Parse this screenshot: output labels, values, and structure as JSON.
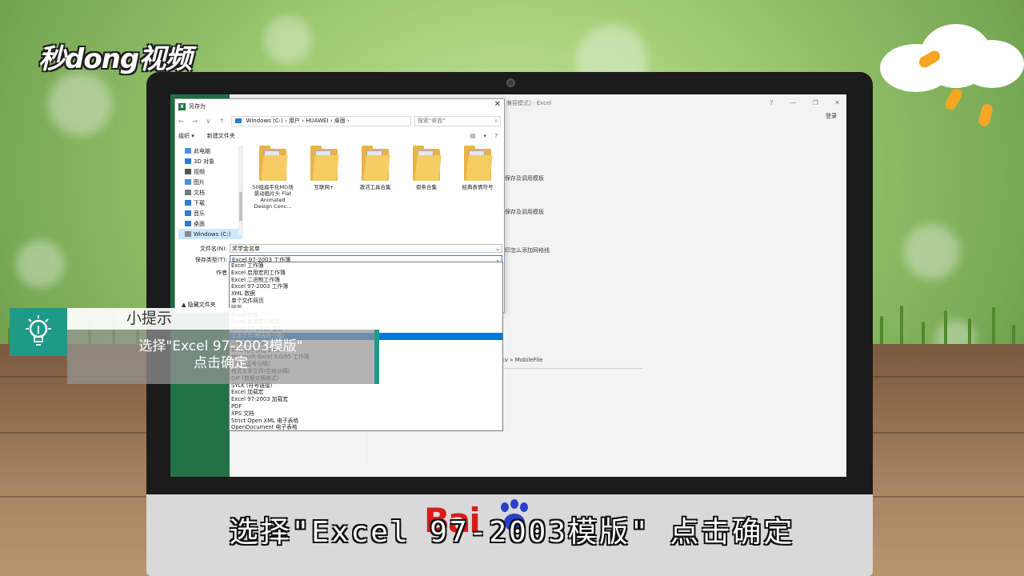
{
  "logo": {
    "text": "秒dong视频"
  },
  "excel": {
    "window_title": "兼容模式] - Excel",
    "window_buttons": "? — ❐ ✕",
    "login": "登录",
    "side_texts": [
      "保存及调用模板",
      "保存及调用模板",
      "印怎么添加网格线",
      "cv » MobileFile"
    ]
  },
  "dialog": {
    "title": "另存为",
    "close": "✕",
    "nav_arrows": "← → ∨ ↑",
    "breadcrumb": "Windows (C:)  ›  用户  ›  HUAWEI  ›  桌面  ›",
    "search_placeholder": "搜索\"桌面\"",
    "toolbar": {
      "organize": "组织 ▾",
      "new_folder": "新建文件夹",
      "view": "▤ ▾  ?"
    },
    "nav_items": [
      {
        "label": "此电脑",
        "color": "#4a90d9"
      },
      {
        "label": "3D 对象",
        "color": "#2b7cd3"
      },
      {
        "label": "视频",
        "color": "#555555"
      },
      {
        "label": "图片",
        "color": "#4a90d9"
      },
      {
        "label": "文档",
        "color": "#777777"
      },
      {
        "label": "下载",
        "color": "#2b7cd3"
      },
      {
        "label": "音乐",
        "color": "#2b7cd3"
      },
      {
        "label": "桌面",
        "color": "#2b7cd3"
      },
      {
        "label": "Windows (C:)",
        "color": "#888888"
      }
    ],
    "files": [
      {
        "name": "50组扁平化MG场景动画片头 Flat Animated Design Conc..."
      },
      {
        "name": "互联网+"
      },
      {
        "name": "激活工具合集"
      },
      {
        "name": "假条合集"
      },
      {
        "name": "经典表情符号"
      }
    ],
    "filename_label": "文件名(N):",
    "filename_value": "奖学金名单",
    "filetype_label": "保存类型(T):",
    "filetype_value": "Excel 97-2003 工作簿",
    "author_label": "作者",
    "hide_folders": "▲ 隐藏文件夹"
  },
  "dropdown": {
    "items": [
      "Excel 工作簿",
      "Excel 启用宏的工作簿",
      "Excel 二进制工作簿",
      "Excel 97-2003 工作簿",
      "XML 数据",
      "单个文件网页",
      "网页",
      "Excel 模板",
      "Excel 启用宏的模板",
      "Excel 97-2003 模板",
      "文本文件(制表符分隔)",
      "Unicode 文本",
      "XML 电子表格 2003",
      "Microsoft Excel 5.0/95 工作簿",
      "CSV (逗号分隔)",
      "格式文本文件(空格分隔)",
      "DIF (数据交换格式)",
      "SYLK (符号链接)",
      "Excel 加载宏",
      "Excel 97-2003 加载宏",
      "PDF",
      "XPS 文档",
      "Strict Open XML 电子表格",
      "OpenDocument 电子表格"
    ],
    "highlighted_index": 10
  },
  "tip": {
    "heading": "小提示",
    "line1": "选择\"Excel 97-2003模版\"",
    "line2": "点击确定"
  },
  "caption": "选择\"Excel 97-2003模版\" 点击确定",
  "watermark": "Bai",
  "colors": {
    "excel_green": "#217346",
    "tip_teal": "#1e9a89",
    "highlight": "#0078d7"
  }
}
